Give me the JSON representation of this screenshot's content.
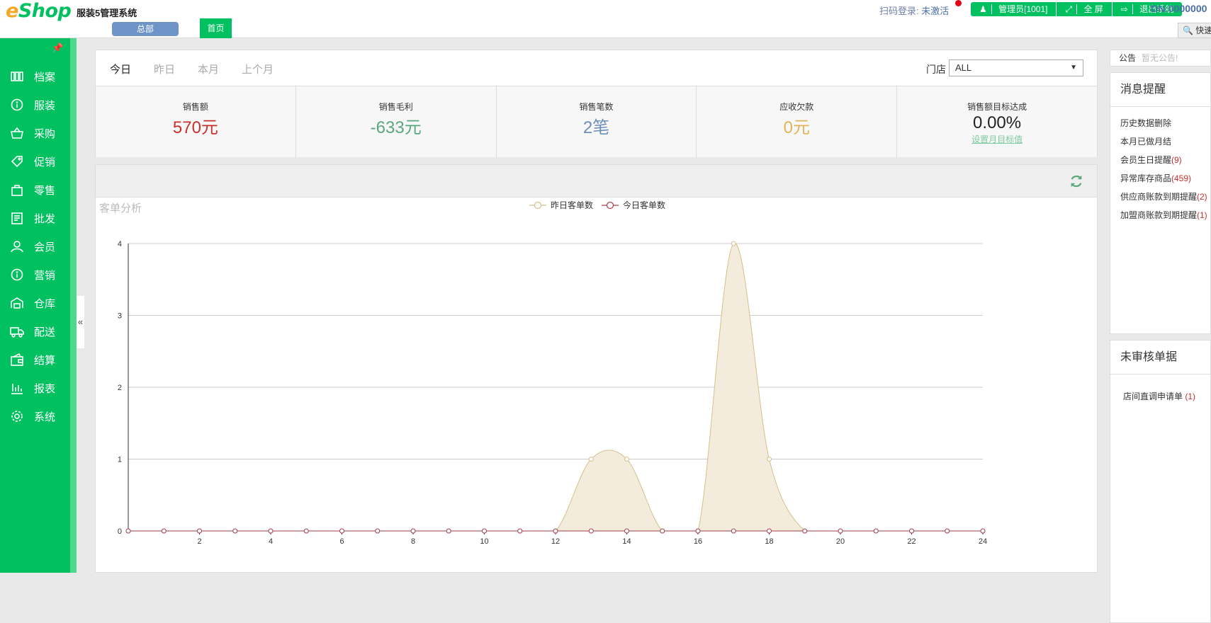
{
  "header": {
    "logo_e": "e",
    "logo_shop": "Shop",
    "system_name": "服装5管理系统",
    "hq_button": "总部",
    "home_tab": "首页",
    "scan_login_label": "扫码登录:",
    "scan_login_status": "未激活",
    "admin_button": "管理员[1001]",
    "fullscreen_button": "全 屏",
    "logout_button": "退出系统",
    "dn": "DN:0000000",
    "quick_search": "快速"
  },
  "sidebar": {
    "collapse_glyph": "«",
    "items": [
      {
        "label": "档案",
        "icon": "archive-icon"
      },
      {
        "label": "服装",
        "icon": "info-circle-icon"
      },
      {
        "label": "采购",
        "icon": "basket-icon"
      },
      {
        "label": "促销",
        "icon": "tag-icon"
      },
      {
        "label": "零售",
        "icon": "shopping-bag-icon"
      },
      {
        "label": "批发",
        "icon": "receipt-icon"
      },
      {
        "label": "会员",
        "icon": "user-icon"
      },
      {
        "label": "营销",
        "icon": "info-circle-icon"
      },
      {
        "label": "仓库",
        "icon": "warehouse-icon"
      },
      {
        "label": "配送",
        "icon": "truck-icon"
      },
      {
        "label": "结算",
        "icon": "wallet-icon"
      },
      {
        "label": "报表",
        "icon": "bar-chart-icon"
      },
      {
        "label": "系统",
        "icon": "gear-icon"
      }
    ]
  },
  "dashboard": {
    "date_tabs": [
      "今日",
      "昨日",
      "本月",
      "上个月"
    ],
    "active_tab": "今日",
    "store_label": "门店",
    "store_value": "ALL",
    "stats": [
      {
        "title": "销售额",
        "value": "570元",
        "color": "#c9302c"
      },
      {
        "title": "销售毛利",
        "value": "-633元",
        "color": "#5aa77b"
      },
      {
        "title": "销售笔数",
        "value": "2笔",
        "color": "#6f8fb8"
      },
      {
        "title": "应收欠款",
        "value": "0元",
        "color": "#e0b45a"
      },
      {
        "title": "销售额目标达成",
        "value": "0.00%",
        "color": "#222222",
        "link": "设置月目标值"
      }
    ]
  },
  "chart_data": {
    "type": "area",
    "title": "客单分析",
    "x": [
      0,
      1,
      2,
      3,
      4,
      5,
      6,
      7,
      8,
      9,
      10,
      11,
      12,
      13,
      14,
      15,
      16,
      17,
      18,
      19,
      20,
      21,
      22,
      23,
      24
    ],
    "xticks": [
      2,
      4,
      6,
      8,
      10,
      12,
      14,
      16,
      18,
      20,
      22,
      24
    ],
    "yticks": [
      0,
      1,
      2,
      3,
      4
    ],
    "ylim": [
      0,
      4
    ],
    "xlim": [
      0,
      24
    ],
    "series": [
      {
        "name": "昨日客单数",
        "color": "#d4c08a",
        "fill": "#f3ecdc",
        "values": [
          0,
          0,
          0,
          0,
          0,
          0,
          0,
          0,
          0,
          0,
          0,
          0,
          0,
          1,
          1,
          0,
          0,
          4,
          1,
          0,
          0,
          0,
          0,
          0,
          0
        ]
      },
      {
        "name": "今日客单数",
        "color": "#a63d4a",
        "fill": "none",
        "values": [
          0,
          0,
          0,
          0,
          0,
          0,
          0,
          0,
          0,
          0,
          0,
          0,
          0,
          0,
          0,
          0,
          0,
          0,
          0,
          0,
          0,
          0,
          0,
          0,
          0
        ]
      }
    ]
  },
  "right_panel": {
    "notice_label": "公告",
    "notice_value": "暂无公告!",
    "messages_title": "消息提醒",
    "messages": [
      {
        "text": "历史数据删除",
        "count": ""
      },
      {
        "text": "本月已做月结",
        "count": ""
      },
      {
        "text": "会员生日提醒",
        "count": "(9)"
      },
      {
        "text": "异常库存商品",
        "count": "(459)"
      },
      {
        "text": "供应商账款到期提醒",
        "count": "(2)"
      },
      {
        "text": "加盟商账款到期提醒",
        "count": "(1)"
      }
    ],
    "unaudited_title": "未审核单据",
    "unaudited": [
      {
        "text": "店间直调申请单 ",
        "count": "(1)"
      }
    ]
  }
}
